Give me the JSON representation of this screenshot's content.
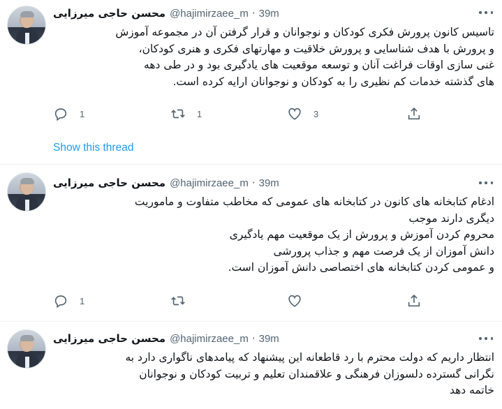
{
  "tweets": [
    {
      "display_name": "محسن حاجی میرزایی",
      "handle": "@hajimirzaee_m",
      "separator": "·",
      "time": "39m",
      "text": "تاسیس کانون پرورش فکری کودکان و نوجوانان و قرار گرفتن آن در مجموعه آموزش\nو پرورش با هدف شناسایی و پرورش خلاقیت و مهارتهای فکری و هنری کودکان،\nغنی سازی اوقات فراغت آنان و توسعه موقعیت های یادگیری بود و در طی دهه\nهای گذشته خدمات کم نظیری را به کودکان و نوجوانان ارایه کرده است.",
      "reply_count": "1",
      "retweet_count": "1",
      "like_count": "3"
    },
    {
      "display_name": "محسن حاجی میرزایی",
      "handle": "@hajimirzaee_m",
      "separator": "·",
      "time": "39m",
      "text": "ادغام کتابخانه های کانون در کتابخانه های عمومی که مخاطب متفاوت و ماموریت\nدیگری دارند موجب\nمحروم کردن آموزش و پرورش از یک موقعیت مهم یادگیری\nدانش آموزان از یک فرصت مهم و جذاب پرورشی\nو عمومی کردن کتابخانه های اختصاصی دانش آموزان است.",
      "reply_count": "1",
      "retweet_count": "",
      "like_count": ""
    },
    {
      "display_name": "محسن حاجی میرزایی",
      "handle": "@hajimirzaee_m",
      "separator": "·",
      "time": "39m",
      "text": "انتظار داریم که دولت محترم با رد قاطعانه این پیشنهاد که پیامدهای ناگواری دارد به\nنگرانی گسترده دلسوزان فرهنگی و علاقمندان تعلیم و تربیت کودکان و نوجوانان\nخاتمه دهد"
    }
  ],
  "show_thread_label": "Show this thread",
  "icons": {
    "reply": "reply-icon",
    "retweet": "retweet-icon",
    "like": "heart-icon",
    "share": "share-icon",
    "more": "more-icon"
  },
  "colors": {
    "text": "#0f1419",
    "secondary": "#536471",
    "link": "#1d9bf0",
    "divider": "#eff3f4"
  }
}
